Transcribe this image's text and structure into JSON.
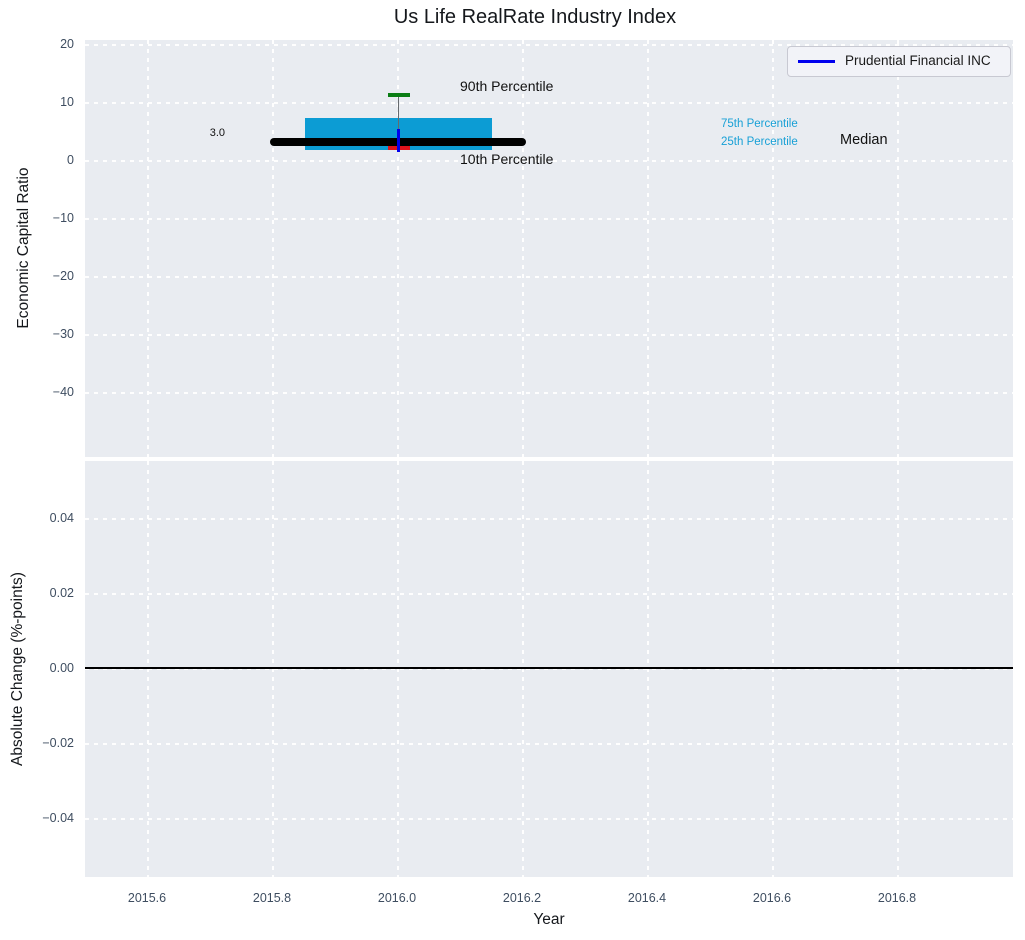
{
  "title": "Us Life RealRate Industry Index",
  "axes": {
    "xlabel": "Year",
    "xticks": [
      "2015.6",
      "2015.8",
      "2016.0",
      "2016.2",
      "2016.4",
      "2016.6",
      "2016.8"
    ],
    "top": {
      "ylabel": "Economic Capital Ratio",
      "yticks": [
        "20",
        "10",
        "0",
        "−10",
        "−20",
        "−30",
        "−40"
      ]
    },
    "bottom": {
      "ylabel": "Absolute Change (%-points)",
      "yticks": [
        "0.04",
        "0.02",
        "0.00",
        "−0.02",
        "−0.04"
      ]
    }
  },
  "legend": {
    "entries": [
      {
        "label": "Prudential Financial INC",
        "line_color": "#0000ee"
      }
    ]
  },
  "annotations": {
    "p90_label": "90th Percentile",
    "p10_label": "10th Percentile",
    "p75_label": "75th Percentile",
    "p25_label": "25th Percentile",
    "median_label": "Median",
    "median_value": "3.0"
  },
  "colors": {
    "box_fill": "#0c9cd4",
    "percentile_text": "#18a0d6",
    "median_line": "#000000",
    "p90_cap": "#0a7d14",
    "p10_cap": "#e3131b",
    "series_line": "#0000ee",
    "axes_background": "#e9ecf1",
    "tick_text": "#3e4d60",
    "grid": "#ffffff"
  },
  "chart_data": [
    {
      "type": "boxplot",
      "title": "Us Life RealRate Industry Index",
      "xlabel": "Year",
      "ylabel": "Economic Capital Ratio",
      "xlim": [
        2015.5,
        2017.0
      ],
      "ylim": [
        -52,
        21
      ],
      "xticks": [
        2015.6,
        2015.8,
        2016.0,
        2016.2,
        2016.4,
        2016.6,
        2016.8
      ],
      "yticks": [
        20,
        10,
        0,
        -10,
        -20,
        -30,
        -40
      ],
      "grid": "dashed-white",
      "legend_position": "upper right",
      "box": {
        "x_center": 2016.0,
        "x_box_range": [
          2015.85,
          2016.15
        ],
        "x_median_range": [
          2015.8,
          2016.2
        ],
        "p90": 10.8,
        "p75": 6.9,
        "median": 3.0,
        "p25": 1.7,
        "p10": 1.5,
        "median_value_label": "3.0"
      },
      "series": [
        {
          "name": "Prudential Financial INC",
          "color": "#0000ee",
          "points": [
            {
              "x": 2016.0,
              "y": 3.0
            }
          ]
        }
      ]
    },
    {
      "type": "line",
      "xlabel": "Year",
      "ylabel": "Absolute Change (%-points)",
      "xlim": [
        2015.5,
        2017.0
      ],
      "ylim": [
        -0.055,
        0.055
      ],
      "xticks": [
        2015.6,
        2015.8,
        2016.0,
        2016.2,
        2016.4,
        2016.6,
        2016.8
      ],
      "yticks": [
        0.04,
        0.02,
        0.0,
        -0.02,
        -0.04
      ],
      "grid": "dashed-white",
      "zero_line_y": 0.0,
      "series": []
    }
  ]
}
